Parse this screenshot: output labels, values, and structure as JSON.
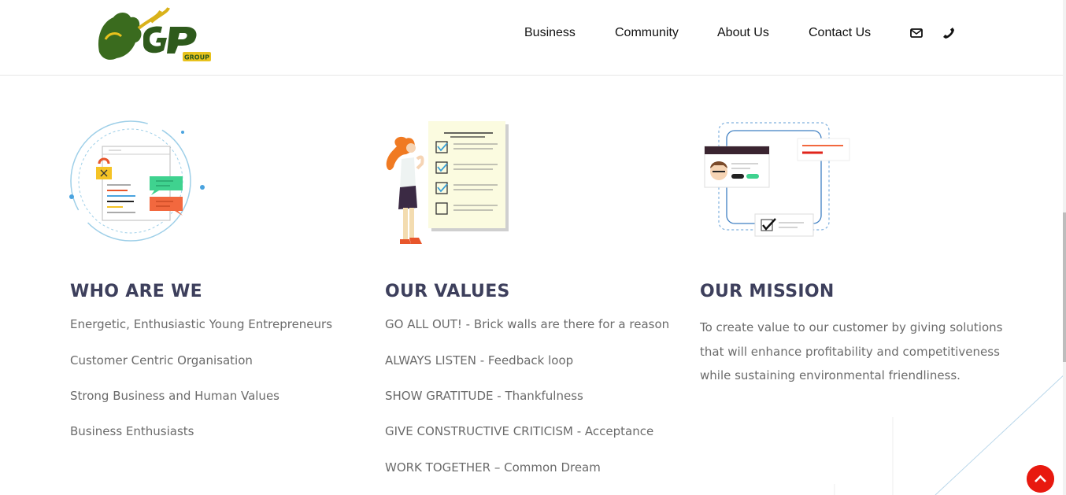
{
  "nav": {
    "items": [
      {
        "label": "Business"
      },
      {
        "label": "Community"
      },
      {
        "label": "About Us"
      },
      {
        "label": "Contact Us"
      }
    ],
    "icons": [
      "envelope-icon",
      "phone-icon"
    ]
  },
  "logo": {
    "text": "GP",
    "subtext": "GROUP",
    "colors": {
      "green": "#2e5a1c",
      "yellow": "#e8c21d"
    }
  },
  "who": {
    "heading": "WHO ARE WE",
    "items": [
      "Energetic, Enthusiastic Young Entrepreneurs",
      "Customer Centric Organisation",
      "Strong Business and Human Values",
      "Business Enthusiasts"
    ]
  },
  "values": {
    "heading": "OUR VALUES",
    "items": [
      "GO ALL OUT! - Brick walls are there for a reason",
      "ALWAYS LISTEN - Feedback loop",
      "SHOW GRATITUDE - Thankfulness",
      "GIVE CONSTRUCTIVE CRITICISM - Acceptance",
      "WORK TOGETHER – Common Dream"
    ]
  },
  "mission": {
    "heading": "OUR MISSION",
    "text": "To create value to our customer by giving solutions that will enhance profitability and competitiveness while sustaining environmental friendliness."
  },
  "colors": {
    "heading": "#3d3f5c",
    "body": "#6b6b6b",
    "accent": "#e8190f"
  }
}
